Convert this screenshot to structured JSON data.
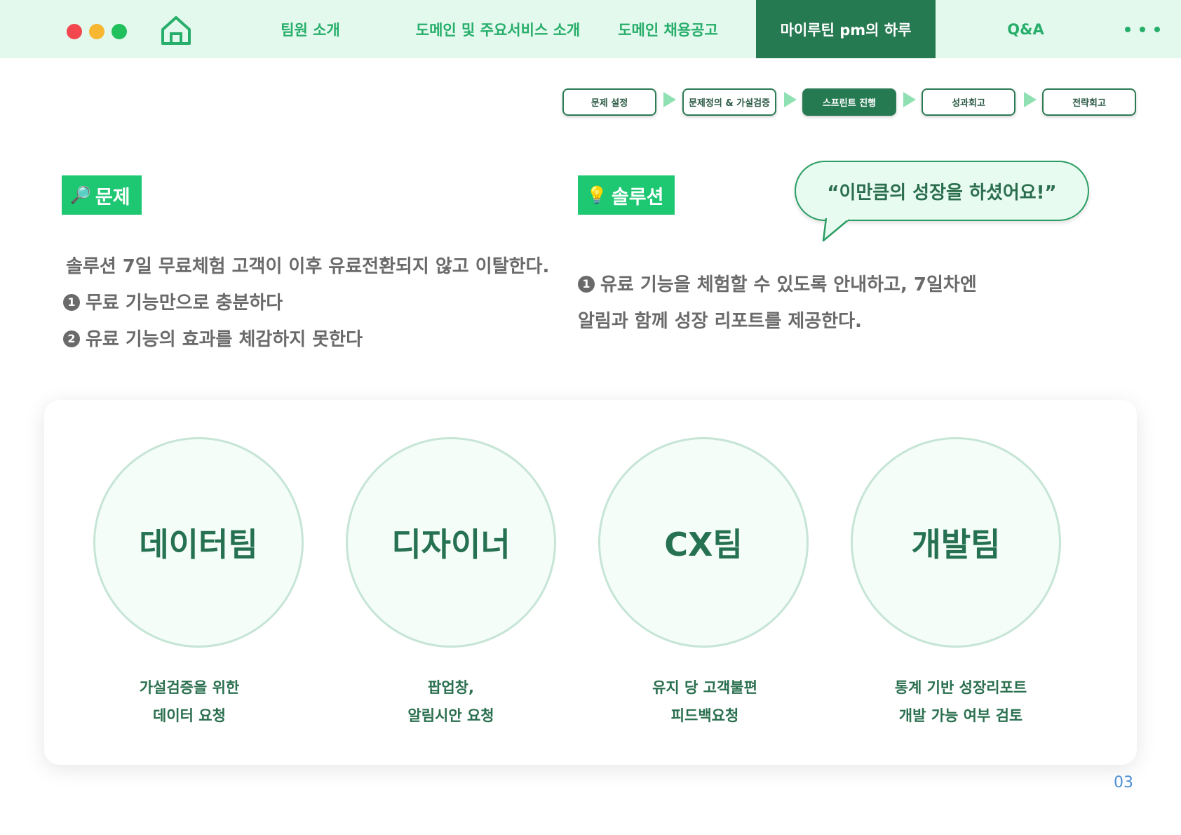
{
  "nav": {
    "items": [
      {
        "label": "팀원 소개"
      },
      {
        "label": "도메인 및 주요서비스 소개"
      },
      {
        "label": "도메인 채용공고"
      },
      {
        "label": "마이루틴 pm의 하루",
        "active": true
      },
      {
        "label": "Q&A"
      }
    ]
  },
  "steps": [
    "문제 설정",
    "문제정의 & 가설검증",
    "스프린트 진행",
    "성과회고",
    "전략회고"
  ],
  "problem": {
    "label": "문제",
    "icon": "🔎",
    "line1": "솔루션 7일 무료체험 고객이 이후 유료전환되지 않고 이탈한다.",
    "bullet1_num": "1",
    "bullet1": "무료 기능만으로 충분하다",
    "bullet2_num": "2",
    "bullet2": "유료 기능의 효과를 체감하지 못한다"
  },
  "solution": {
    "label": "솔루션",
    "icon": "💡",
    "bubble": "“이만큼의 성장을 하셨어요!”",
    "bullet1_num": "1",
    "line1": "유료 기능을 체험할 수 있도록 안내하고, 7일차엔",
    "line2": "알림과 함께 성장 리포트를 제공한다."
  },
  "teams": [
    {
      "name": "데이터팀",
      "desc1": "가설검증을 위한",
      "desc2": "데이터 요청"
    },
    {
      "name": "디자이너",
      "desc1": "팝업창,",
      "desc2": "알림시안 요청"
    },
    {
      "name": "CX팀",
      "desc1": "유지 당 고객불편",
      "desc2": "피드백요청"
    },
    {
      "name": "개발팀",
      "desc1": "통계 기반 성장리포트",
      "desc2": "개발 가능 여부 검토"
    }
  ],
  "page_number": "03",
  "colors": {
    "accent": "#267a52",
    "label_green": "#1ec772",
    "topbar": "#e3f9ee"
  }
}
